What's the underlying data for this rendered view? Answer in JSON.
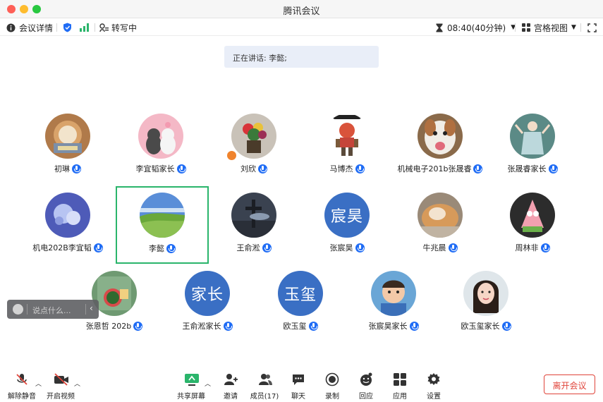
{
  "app": {
    "title": "腾讯会议"
  },
  "infobar": {
    "details_label": "会议详情",
    "transcribe_label": "转写中",
    "timer": "08:40(40分钟)",
    "view_label": "宫格视图"
  },
  "speaking": {
    "text": "正在讲话: 李懿;"
  },
  "participants": [
    {
      "name": "初琳",
      "avatar": "photo-bakery"
    },
    {
      "name": "李宜韬家长",
      "avatar": "photo-cats"
    },
    {
      "name": "刘欣",
      "avatar": "photo-flowers"
    },
    {
      "name": "马博杰",
      "avatar": "photo-robot"
    },
    {
      "name": "机械电子201b张晟睿",
      "avatar": "photo-dog"
    },
    {
      "name": "张晟睿家长",
      "avatar": "photo-dancer"
    },
    {
      "name": "机电202B李宜韬",
      "avatar": "photo-bubbles"
    },
    {
      "name": "李懿",
      "avatar": "photo-meadow"
    },
    {
      "name": "王俞淞",
      "avatar": "photo-cross"
    },
    {
      "name": "张宸昊",
      "avatar_text": "宸昊"
    },
    {
      "name": "牛兆晨",
      "avatar": "photo-cat"
    },
    {
      "name": "周林非",
      "avatar": "photo-patrick"
    },
    {
      "name": "张恩哲 202b",
      "avatar": "photo-cartoon"
    },
    {
      "name": "王俞淞家长",
      "avatar_text": "家长"
    },
    {
      "name": "欧玉玺",
      "avatar_text": "玉玺"
    },
    {
      "name": "张宸昊家长",
      "avatar": "photo-baby"
    },
    {
      "name": "欧玉玺家长",
      "avatar": "photo-woman"
    }
  ],
  "chat": {
    "placeholder": "说点什么..."
  },
  "toolbar": {
    "unmute_label": "解除静音",
    "video_label": "开启视频",
    "share_label": "共享屏幕",
    "invite_label": "邀请",
    "members_label": "成员(17)",
    "chat_label": "聊天",
    "record_label": "录制",
    "react_label": "回应",
    "apps_label": "应用",
    "settings_label": "设置",
    "leave_label": "离开会议"
  },
  "colors": {
    "accent": "#1f6cf5",
    "active_border": "#2ab56b",
    "leave": "#e0443a",
    "avatar_text_bg": "#3a6fc4"
  }
}
